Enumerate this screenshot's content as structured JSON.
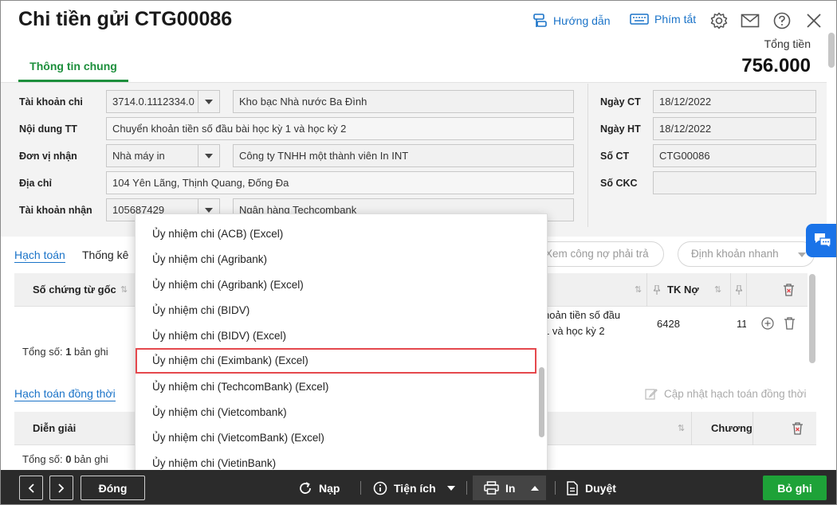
{
  "header": {
    "title": "Chi tiền gửi CTG00086",
    "guide_label": "Hướng dẫn",
    "shortcut_label": "Phím tắt",
    "total_label": "Tổng tiền",
    "total_value": "756.000"
  },
  "tabs": {
    "main": "Thông tin chung"
  },
  "form": {
    "account_label": "Tài khoản chi",
    "account_value": "3714.0.1112334.0",
    "account_name": "Kho bạc Nhà nước Ba Đình",
    "content_label": "Nội dung TT",
    "content_value": "Chuyển khoản tiền số đầu bài học kỳ 1 và học kỳ 2",
    "receiver_label": "Đơn vị nhận",
    "receiver_value": "Nhà máy in",
    "receiver_name": "Công ty TNHH một thành viên In INT",
    "address_label": "Địa chỉ",
    "address_value": "104 Yên Lãng, Thịnh Quang, Đống Đa",
    "recv_account_label": "Tài khoản nhận",
    "recv_account_value": "105687429",
    "recv_bank": "Ngân hàng Techcombank",
    "date_ct_label": "Ngày CT",
    "date_ct_value": "18/12/2022",
    "date_ht_label": "Ngày HT",
    "date_ht_value": "18/12/2022",
    "so_ct_label": "Số CT",
    "so_ct_value": "CTG00086",
    "so_ckc_label": "Số CKC",
    "so_ckc_value": ""
  },
  "detail": {
    "tab_hach_toan": "Hạch toán",
    "tab_thong_ke": "Thống kê",
    "btn_xem_cong_no": "Xem công nợ phải trả",
    "btn_dinh_khoan": "Định khoản nhanh",
    "col_so_chung_tu": "Số chứng từ gốc",
    "col_dien_giai_partial": "i",
    "col_tk_no": "TK Nợ",
    "row1_desc_line1": "hoản tiền số đầu",
    "row1_desc_line2": "1 và học kỳ 2",
    "row1_tk_no": "6428",
    "row1_next": "11",
    "total_prefix": "Tổng số: ",
    "total_count": "1",
    "total_suffix": " bản ghi"
  },
  "concurrent": {
    "tab_label": "Hạch toán đồng thời",
    "update_label": "Cập nhật hạch toán đồng thời",
    "col_dien_giai": "Diễn giải",
    "col_chuong": "Chương",
    "total_prefix": "Tổng số: ",
    "total_count": "0",
    "total_suffix": " bản ghi"
  },
  "print_menu": {
    "items": [
      "Ủy nhiệm chi (ACB) (Excel)",
      "Ủy nhiệm chi (Agribank)",
      "Ủy nhiệm chi (Agribank) (Excel)",
      "Ủy nhiệm chi (BIDV)",
      "Ủy nhiệm chi (BIDV) (Excel)",
      "Ủy nhiệm chi (Eximbank) (Excel)",
      "Ủy nhiệm chi (TechcomBank) (Excel)",
      "Ủy nhiệm chi (Vietcombank)",
      "Ủy nhiệm chi (VietcomBank) (Excel)",
      "Ủy nhiệm chi (VietinBank)"
    ],
    "highlighted_index": 5
  },
  "footer": {
    "close_label": "Đóng",
    "reload_label": "Nạp",
    "utility_label": "Tiện ích",
    "print_label": "In",
    "approve_label": "Duyệt",
    "discard_label": "Bỏ ghi"
  },
  "colors": {
    "accent": "#1d8f3c",
    "link": "#1a73c8",
    "highlight": "#e5484d",
    "footer": "#2b2b2b",
    "primary": "#1ea238"
  }
}
